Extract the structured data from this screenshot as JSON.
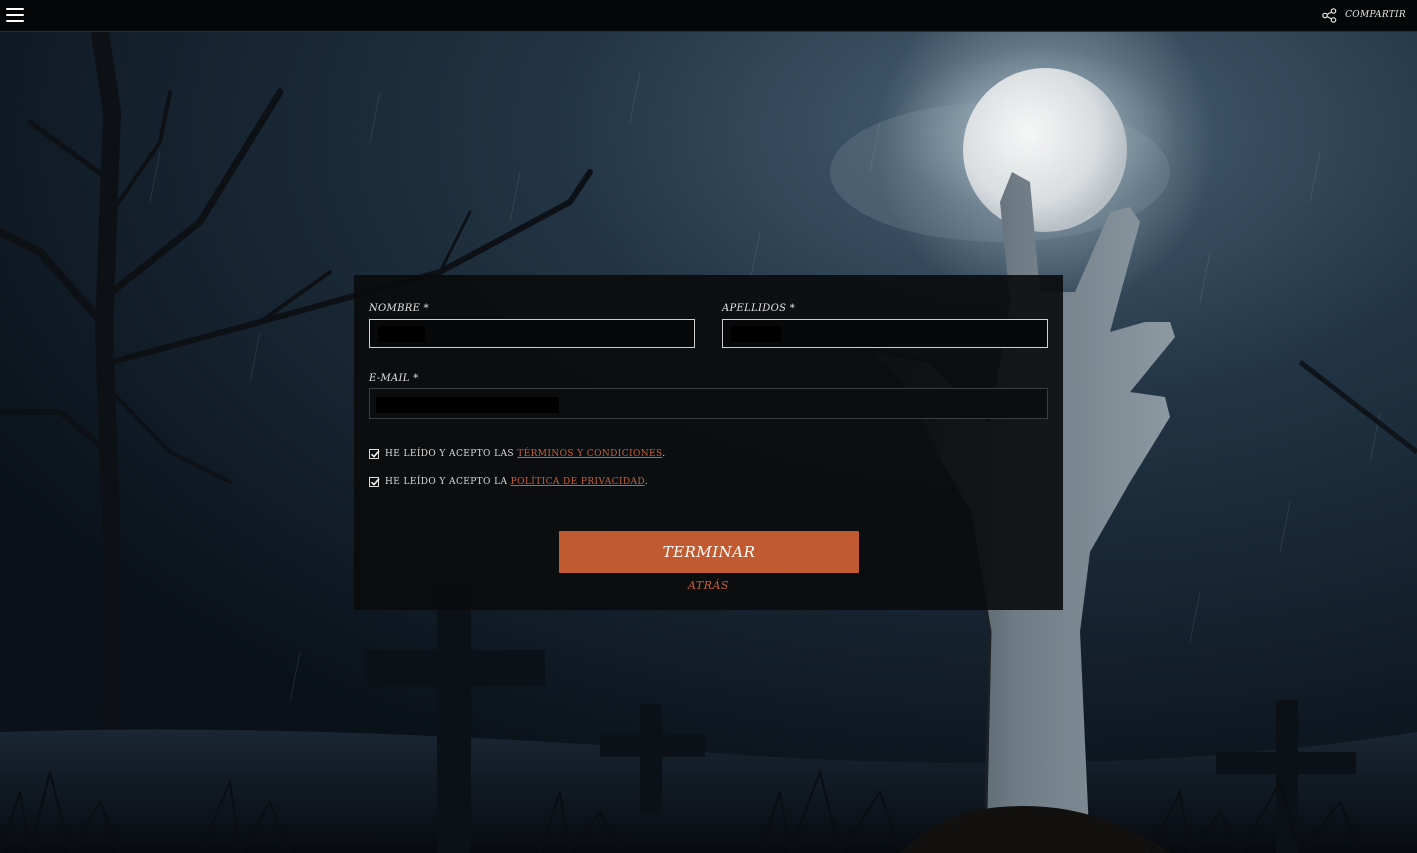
{
  "topbar": {
    "menu_icon": "hamburger-menu-icon",
    "share_icon": "share-icon",
    "share_label": "COMPARTIR"
  },
  "background": {
    "description_icon": "graveyard-scene",
    "colors": {
      "sky": "#1b2a38",
      "moon": "#e9ecef",
      "ground": "#0b1118"
    }
  },
  "form": {
    "nombre": {
      "label": "NOMBRE",
      "required": "*",
      "value": ""
    },
    "apellidos": {
      "label": "APELLIDOS",
      "required": "*",
      "value": ""
    },
    "email": {
      "label": "E-MAIL",
      "required": "*",
      "value": ""
    },
    "terms": {
      "prefix": "HE LEÍDO Y ACEPTO LAS",
      "link": "TÉRMINOS Y CONDICIONES",
      "suffix": ".",
      "checked": true
    },
    "privacy": {
      "prefix": "HE LEÍDO Y ACEPTO LA",
      "link": "POLÍTICA DE PRIVACIDAD",
      "suffix": ".",
      "checked": true
    },
    "submit_label": "TERMINAR",
    "back_label": "ATRÁS"
  },
  "colors": {
    "accent": "#c25a31",
    "link": "#c8603a",
    "panel": "#0a0b0c"
  }
}
